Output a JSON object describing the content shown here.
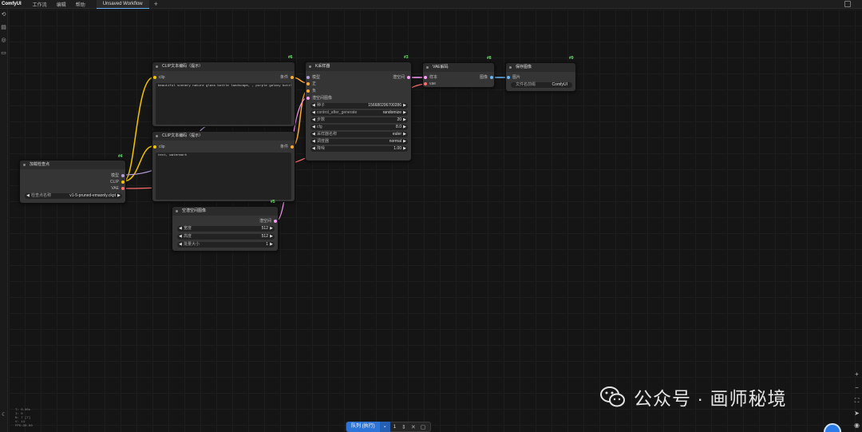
{
  "app": {
    "brand": "ComfyUI"
  },
  "menu": [
    "工作流",
    "编辑",
    "帮助"
  ],
  "tab": {
    "title": "Unsaved Workflow",
    "add": "+"
  },
  "nodes": {
    "checkpoint": {
      "id": "#4",
      "title": "加载检查点",
      "outputs": [
        "模型",
        "CLIP",
        "VAE"
      ],
      "widget_label": "检查点名称",
      "widget_value": "v1-5-pruned-emaonly.ckpt"
    },
    "clip_pos": {
      "id": "#6",
      "title": "CLIP文本编码（提示）",
      "input": "clip",
      "output": "条件",
      "text": "beautiful scenery nature glass bottle landscape, , purple galaxy bottle,"
    },
    "clip_neg": {
      "id": "#7",
      "title": "CLIP文本编码（提示）",
      "input": "clip",
      "output": "条件",
      "text": "text, watermark"
    },
    "latent": {
      "id": "#5",
      "title": "空潜空间图像",
      "output": "潜空间",
      "widgets": [
        {
          "label": "宽度",
          "value": "512"
        },
        {
          "label": "高度",
          "value": "512"
        },
        {
          "label": "批量大小",
          "value": "1"
        }
      ]
    },
    "ksampler": {
      "id": "#3",
      "title": "K采样器",
      "inputs": [
        "模型",
        "正",
        "负",
        "潜空间图像"
      ],
      "output": "潜空间",
      "widgets": [
        {
          "label": "种子",
          "value": "156680206700286"
        },
        {
          "label": "control_after_generate",
          "value": "randomize"
        },
        {
          "label": "步数",
          "value": "20"
        },
        {
          "label": "cfg",
          "value": "8.0"
        },
        {
          "label": "采样器名称",
          "value": "euler"
        },
        {
          "label": "调度器",
          "value": "normal"
        },
        {
          "label": "降噪",
          "value": "1.00"
        }
      ]
    },
    "vae_decode": {
      "id": "#8",
      "title": "VAE解码",
      "inputs": [
        "样本",
        "vae"
      ],
      "output": "图像"
    },
    "save_image": {
      "id": "#9",
      "title": "保存图像",
      "input": "图片",
      "widget_label": "文件名前缀",
      "widget_value": "ComfyUI"
    }
  },
  "runbar": {
    "run_label": "队列 (执行)",
    "count": "1"
  },
  "stats": [
    "T: 0.00s",
    "I: 0",
    "N: 7 [7]",
    "V: 14",
    "FPS:30.00"
  ],
  "watermark": {
    "text": "公众号 · 画师秘境"
  },
  "colors": {
    "clip": "#f4c400",
    "model": "#b39ddb",
    "vae": "#ff6e6e",
    "latent": "#ff9cf9",
    "conditioning": "#ffa931",
    "image": "#64b5f6",
    "run": "#2d74d8"
  }
}
